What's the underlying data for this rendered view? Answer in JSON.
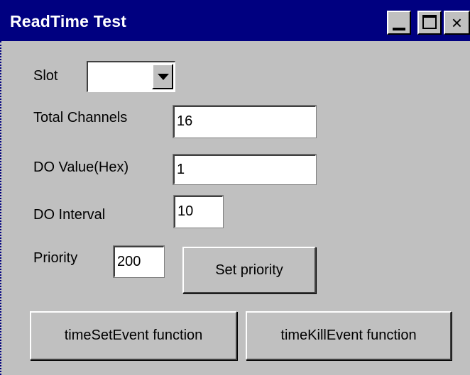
{
  "window": {
    "title": "ReadTime Test",
    "minimize_icon": "minimize-icon",
    "maximize_icon": "maximize-icon",
    "close_glyph": "×"
  },
  "form": {
    "slot_label": "Slot",
    "slot_value": "",
    "total_channels_label": "Total Channels",
    "total_channels_value": "16",
    "do_value_label": "DO Value(Hex)",
    "do_value_value": "1",
    "do_interval_label": "DO Interval",
    "do_interval_value": "10",
    "priority_label": "Priority",
    "priority_value": "200"
  },
  "buttons": {
    "set_priority": "Set priority",
    "time_set_event": "timeSetEvent function",
    "time_kill_event": "timeKillEvent  function"
  },
  "colors": {
    "titlebar": "#000080",
    "face": "#c0c0c0",
    "field": "#ffffff"
  }
}
